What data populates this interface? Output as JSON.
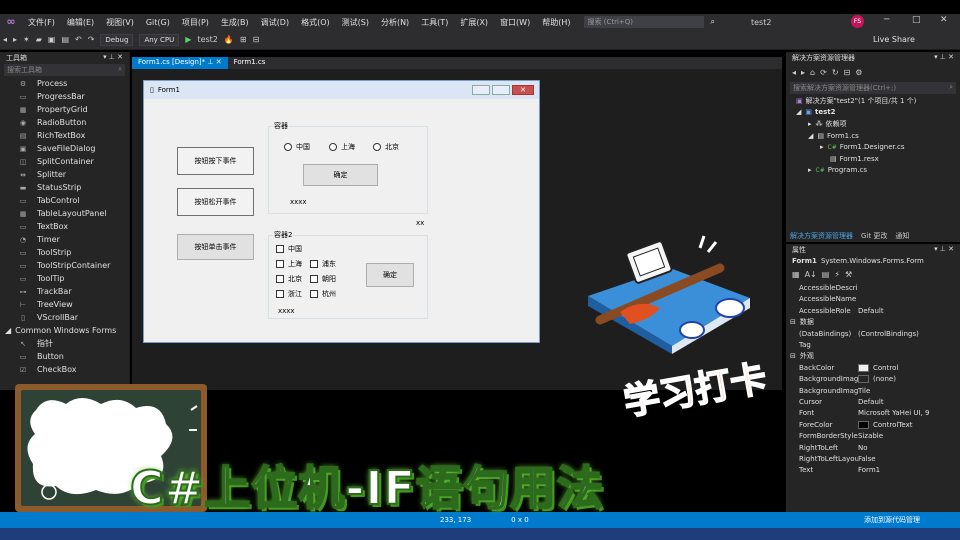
{
  "menu": {
    "items": [
      "文件(F)",
      "编辑(E)",
      "视图(V)",
      "Git(G)",
      "项目(P)",
      "生成(B)",
      "调试(D)",
      "格式(O)",
      "测试(S)",
      "分析(N)",
      "工具(T)",
      "扩展(X)",
      "窗口(W)",
      "帮助(H)"
    ],
    "search_placeholder": "搜索 (Ctrl+Q)",
    "window_title": "test2",
    "avatar": "FS"
  },
  "toolbar": {
    "config": "Debug",
    "platform": "Any CPU",
    "run_target": "test2",
    "live_share": "Live Share"
  },
  "toolbox": {
    "title": "工具箱",
    "search_placeholder": "搜索工具箱",
    "items": [
      "Process",
      "ProgressBar",
      "PropertyGrid",
      "RadioButton",
      "RichTextBox",
      "SaveFileDialog",
      "SplitContainer",
      "Splitter",
      "StatusStrip",
      "TabControl",
      "TableLayoutPanel",
      "TextBox",
      "Timer",
      "ToolStrip",
      "ToolStripContainer",
      "ToolTip",
      "TrackBar",
      "TreeView",
      "VScrollBar"
    ],
    "group": "Common Windows Forms",
    "group_items": [
      "指针",
      "Button",
      "CheckBox"
    ]
  },
  "tabs": [
    {
      "label": "Form1.cs [Design]*"
    },
    {
      "label": "Form1.cs"
    }
  ],
  "form": {
    "title": "Form1",
    "btn_down": "按钮按下事件",
    "btn_up": "按钮松开事件",
    "btn_click": "按钮单击事件",
    "group1": "容器",
    "radios": [
      "中国",
      "上海",
      "北京"
    ],
    "ok1": "确定",
    "label1": "xxxx",
    "label_xx": "xx",
    "group2": "容器2",
    "checks_left": [
      "中国",
      "上海",
      "北京",
      "浙江"
    ],
    "checks_right": [
      "浦东",
      "朝阳",
      "杭州"
    ],
    "ok2": "确定",
    "label2": "xxxx"
  },
  "solution": {
    "title": "解决方案资源管理器",
    "search": "搜索解决方案资源管理器(Ctrl+;)",
    "tree": [
      "解决方案\"test2\"(1 个项目/共 1 个)",
      "test2",
      "依赖项",
      "Form1.cs",
      "Form1.Designer.cs",
      "Form1.resx",
      "Program.cs"
    ],
    "tabs": [
      "解决方案资源管理器",
      "Git 更改",
      "通知"
    ]
  },
  "properties": {
    "title": "属性",
    "object": "Form1",
    "type": "System.Windows.Forms.Form",
    "rows": [
      {
        "name": "AccessibleDescript",
        "value": ""
      },
      {
        "name": "AccessibleName",
        "value": ""
      },
      {
        "name": "AccessibleRole",
        "value": "Default"
      }
    ],
    "cat_data": "数据",
    "data_rows": [
      {
        "name": "(DataBindings)",
        "value": "(ControlBindings)"
      },
      {
        "name": "Tag",
        "value": ""
      }
    ],
    "cat_appearance": "外观",
    "appear_rows": [
      {
        "name": "BackColor",
        "value": "Control",
        "swatch": "#f0f0f0"
      },
      {
        "name": "BackgroundImage",
        "value": "(none)",
        "swatch": "#252526"
      },
      {
        "name": "BackgroundImageL",
        "value": "Tile"
      },
      {
        "name": "Cursor",
        "value": "Default"
      },
      {
        "name": "Font",
        "value": "Microsoft YaHei UI, 9"
      },
      {
        "name": "ForeColor",
        "value": "ControlText",
        "swatch": "#000000"
      },
      {
        "name": "FormBorderStyle",
        "value": "Sizable"
      },
      {
        "name": "RightToLeft",
        "value": "No"
      },
      {
        "name": "RightToLeftLayout",
        "value": "False"
      },
      {
        "name": "Text",
        "value": "Form1"
      }
    ]
  },
  "status": {
    "position": "233, 173",
    "size": "0 x 0",
    "source_control": "添加到源代码管理"
  },
  "overlay": {
    "caption": "C#上位机-IF语句用法",
    "stamp": "学习打卡"
  },
  "colors": {
    "accent": "#007acc",
    "brand": "#b180d7",
    "caption_glow": "#6fcf3a",
    "stamp": "#e8782a"
  }
}
